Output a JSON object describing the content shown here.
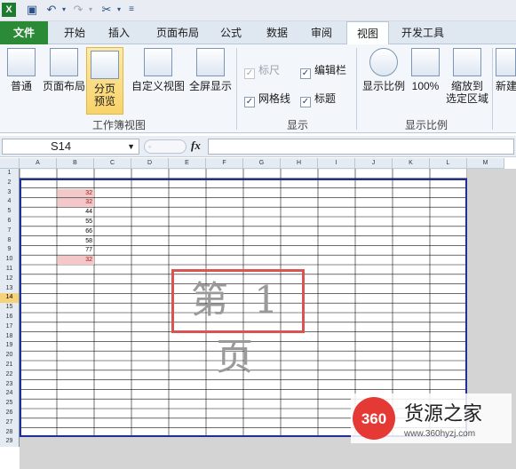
{
  "qat": {
    "icons": [
      "excel-icon",
      "save-icon",
      "undo-icon",
      "redo-icon",
      "customize-icon"
    ]
  },
  "tabs": [
    {
      "label": "文件",
      "kind": "file"
    },
    {
      "label": "开始"
    },
    {
      "label": "插入"
    },
    {
      "label": "页面布局"
    },
    {
      "label": "公式"
    },
    {
      "label": "数据"
    },
    {
      "label": "审阅"
    },
    {
      "label": "视图",
      "kind": "active"
    },
    {
      "label": "开发工具"
    }
  ],
  "ribbon": {
    "normal": "普通",
    "page_layout": "页面布局",
    "page_break_preview": "分页\n预览",
    "custom_view": "自定义视图",
    "full_screen": "全屏显示",
    "group_workbook_views": "工作簿视图",
    "show": {
      "ruler": "标尺",
      "formula_bar": "编辑栏",
      "gridlines": "网格线",
      "headings": "标题",
      "group": "显示"
    },
    "zoom": {
      "zoom": "显示比例",
      "hundred": "100%",
      "zoom_to_selection": "缩放到\n选定区域",
      "new_window": "新建",
      "group": "显示比例"
    }
  },
  "formula_bar": {
    "name_box": "S14",
    "fx": "fx",
    "value": ""
  },
  "sheet": {
    "columns": [
      "A",
      "B",
      "C",
      "D",
      "E",
      "F",
      "G",
      "H",
      "I",
      "J",
      "K",
      "L",
      "M"
    ],
    "rows": [
      "1",
      "2",
      "3",
      "4",
      "5",
      "6",
      "7",
      "8",
      "9",
      "10",
      "11",
      "12",
      "13",
      "14",
      "15",
      "16",
      "17",
      "18",
      "19",
      "20",
      "21",
      "22",
      "23",
      "24",
      "25",
      "26",
      "27",
      "28",
      "29"
    ],
    "selected_row": "14",
    "b_values": [
      {
        "row": 3,
        "v": "32",
        "hl": true
      },
      {
        "row": 4,
        "v": "32",
        "hl": true
      },
      {
        "row": 5,
        "v": "44",
        "hl": false
      },
      {
        "row": 6,
        "v": "55",
        "hl": false
      },
      {
        "row": 7,
        "v": "66",
        "hl": false
      },
      {
        "row": 8,
        "v": "58",
        "hl": false
      },
      {
        "row": 9,
        "v": "77",
        "hl": false
      },
      {
        "row": 10,
        "v": "32",
        "hl": true
      }
    ],
    "page_watermark": "第 1 页"
  },
  "logo": {
    "number": "360",
    "name": "货源之家",
    "url": "www.360hyzj.com"
  }
}
